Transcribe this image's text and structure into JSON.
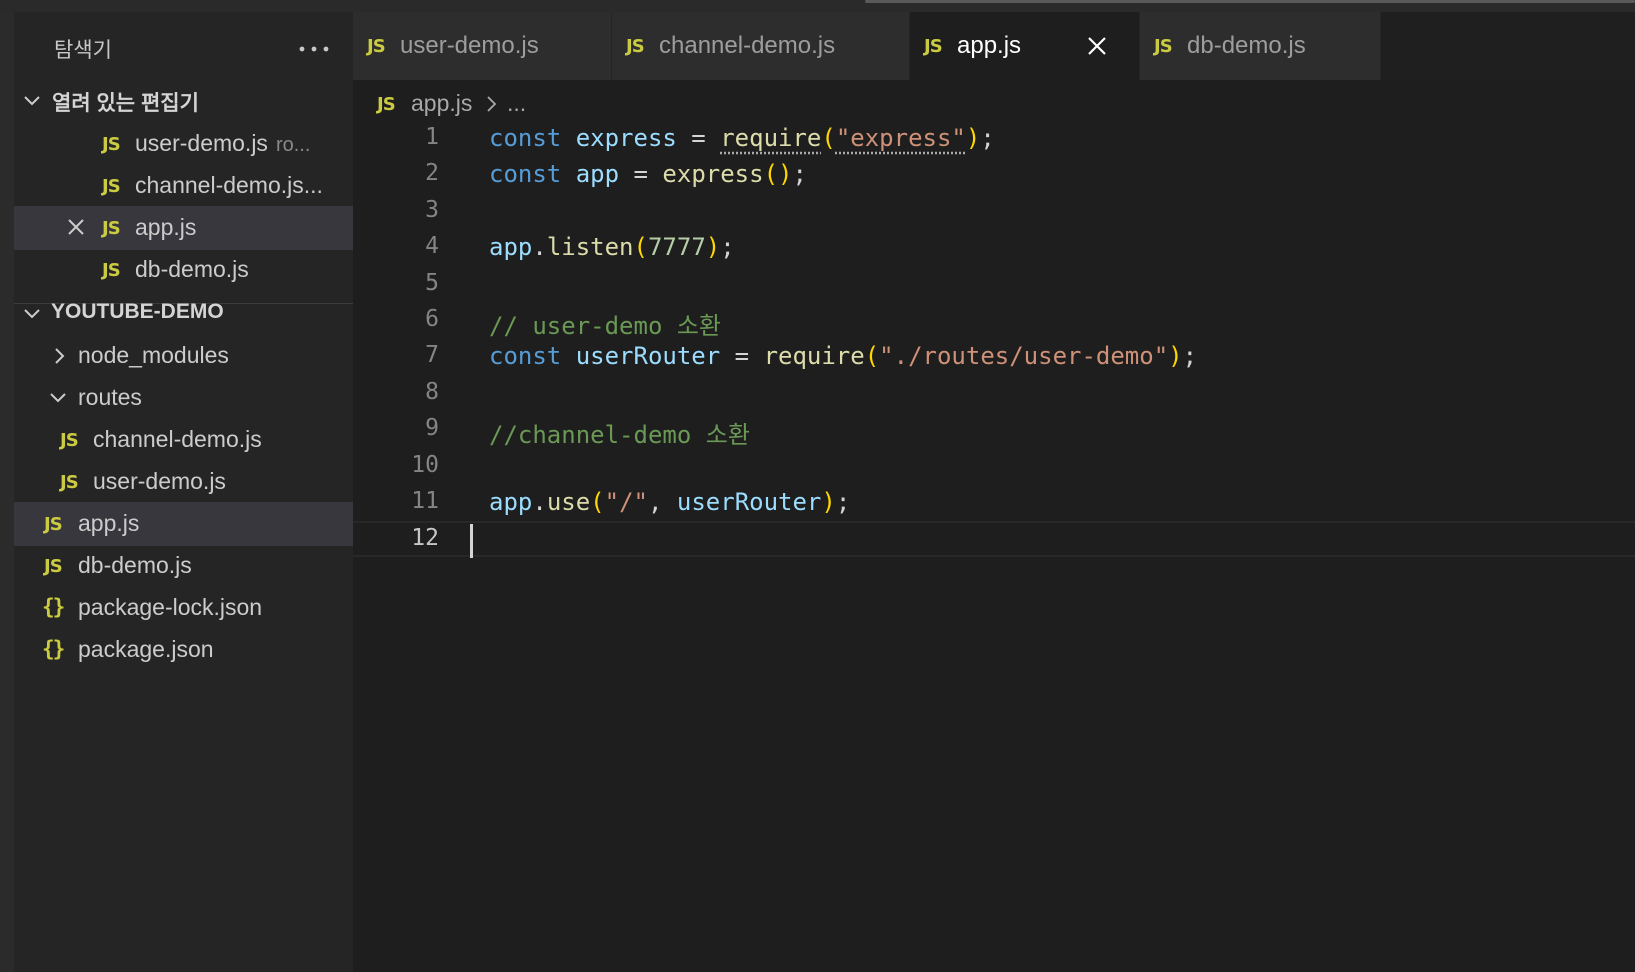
{
  "sidebar": {
    "title": "탐색기",
    "more": "···",
    "open_editors": {
      "header": "열려 있는 편집기",
      "items": [
        {
          "icon": "JS",
          "label": "user-demo.js",
          "sub": "ro..."
        },
        {
          "icon": "JS",
          "label": "channel-demo.js...",
          "sub": ""
        },
        {
          "icon": "JS",
          "label": "app.js",
          "sub": ""
        },
        {
          "icon": "JS",
          "label": "db-demo.js",
          "sub": ""
        }
      ]
    },
    "project": {
      "header": "YOUTUBE-DEMO",
      "items": [
        {
          "type": "folder",
          "label": "node_modules"
        },
        {
          "type": "folder",
          "label": "routes"
        },
        {
          "type": "file",
          "icon": "JS",
          "label": "channel-demo.js"
        },
        {
          "type": "file",
          "icon": "JS",
          "label": "user-demo.js"
        },
        {
          "type": "file",
          "icon": "JS",
          "label": "app.js"
        },
        {
          "type": "file",
          "icon": "JS",
          "label": "db-demo.js"
        },
        {
          "type": "file",
          "icon": "{}",
          "label": "package-lock.json"
        },
        {
          "type": "file",
          "icon": "{}",
          "label": "package.json"
        }
      ]
    }
  },
  "tabs": [
    {
      "icon": "JS",
      "label": "user-demo.js"
    },
    {
      "icon": "JS",
      "label": "channel-demo.js"
    },
    {
      "icon": "JS",
      "label": "app.js"
    },
    {
      "icon": "JS",
      "label": "db-demo.js"
    }
  ],
  "breadcrumb": {
    "icon": "JS",
    "file": "app.js",
    "more": "..."
  },
  "editor": {
    "line_numbers": [
      "1",
      "2",
      "3",
      "4",
      "5",
      "6",
      "7",
      "8",
      "9",
      "10",
      "11",
      "12"
    ],
    "current_line": "12",
    "lines": {
      "l1": {
        "t1": "const",
        "t2": "express",
        "t3": " = ",
        "t4": "require",
        "t5": "(",
        "t6": "\"express\"",
        "t7": ")",
        "t8": ";"
      },
      "l2": {
        "t1": "const",
        "t2": "app",
        "t3": " = ",
        "t4": "express",
        "t5": "()",
        "t6": ";"
      },
      "l4": {
        "t1": "app",
        "t2": ".",
        "t3": "listen",
        "t4": "(",
        "t5": "7777",
        "t6": ")",
        "t7": ";"
      },
      "l6": {
        "t1": "// user-demo 소환"
      },
      "l7": {
        "t1": "const",
        "t2": "userRouter",
        "t3": " = ",
        "t4": "require",
        "t5": "(",
        "t6": "\"./routes/user-demo\"",
        "t7": ")",
        "t8": ";"
      },
      "l9": {
        "t1": "//channel-demo 소환"
      },
      "l11": {
        "t1": "app",
        "t2": ".",
        "t3": "use",
        "t4": "(",
        "t5": "\"/\"",
        "t6": ", ",
        "t7": "userRouter",
        "t8": ")",
        "t9": ";"
      }
    }
  },
  "colors": {
    "keyword": "#569cd6",
    "variable": "#9cdcfe",
    "function": "#dcdcaa",
    "string": "#ce9178",
    "number": "#b5cea8",
    "comment": "#6a9955",
    "js_icon": "#cbcb41"
  }
}
